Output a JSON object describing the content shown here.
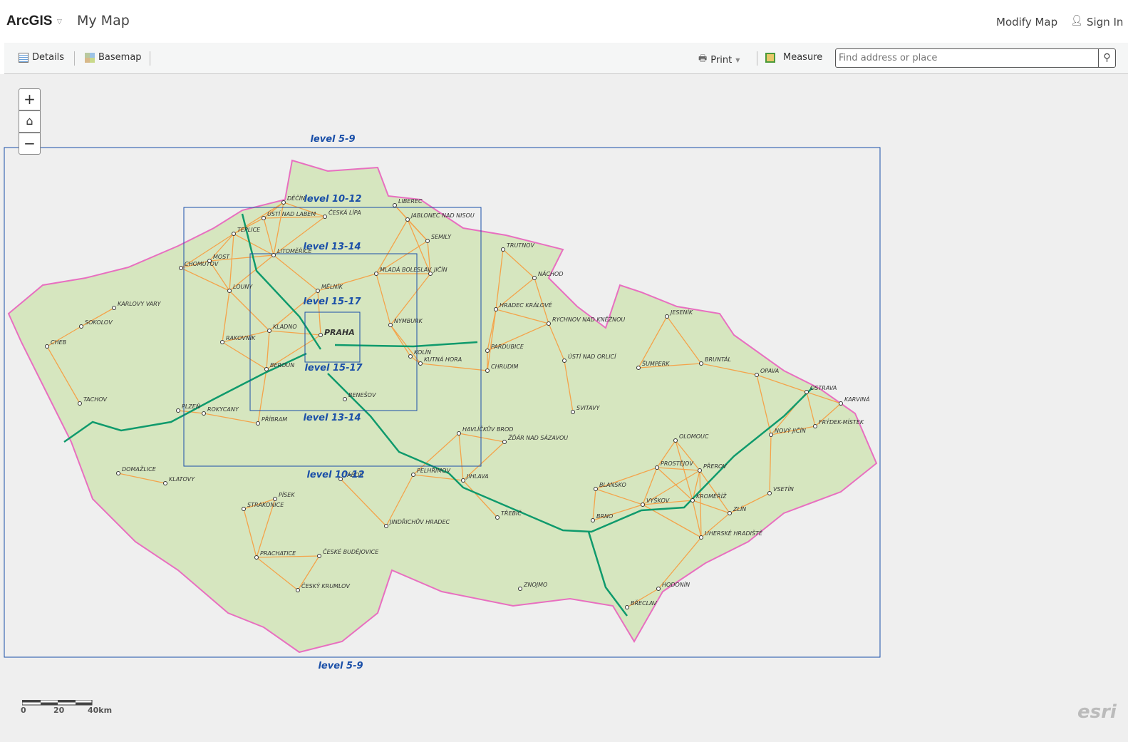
{
  "header": {
    "brand": "ArcGIS",
    "title": "My Map",
    "modify": "Modify Map",
    "sign_in": "Sign In"
  },
  "toolbar": {
    "details": "Details",
    "basemap": "Basemap",
    "print": "Print",
    "measure": "Measure",
    "search_placeholder": "Find address or place"
  },
  "map": {
    "zoom_in": "+",
    "zoom_out": "−",
    "levels": {
      "l5_9": "level 5-9",
      "l10_12": "level 10-12",
      "l13_14": "level 13-14",
      "l15_17": "level 15-17"
    },
    "cities": [
      "Praha",
      "Brno",
      "Ostrava",
      "Plzeň",
      "Olomouc",
      "Liberec",
      "Ústí nad Labem",
      "Hradec Králové",
      "Pardubice",
      "České Budějovice",
      "Jihlava",
      "Zlín",
      "Karlovy Vary",
      "Cheb",
      "Sokolov",
      "Chomutov",
      "Most",
      "Teplice",
      "Děčín",
      "Česká Lípa",
      "Jablonec nad Nisou",
      "Mladá Boleslav",
      "Mělník",
      "Kladno",
      "Beroun",
      "Rakovník",
      "Louny",
      "Litoměřice",
      "Nymburk",
      "Kolín",
      "Kutná Hora",
      "Chrudim",
      "Jičín",
      "Trutnov",
      "Náchod",
      "Semily",
      "Rychnov nad Kněžnou",
      "Ústí nad Orlicí",
      "Šumperk",
      "Jeseník",
      "Bruntál",
      "Opava",
      "Karviná",
      "Frýdek-Místek",
      "Nový Jičín",
      "Přerov",
      "Prostějov",
      "Kroměříž",
      "Vsetín",
      "Uherské Hradiště",
      "Hodonín",
      "Břeclav",
      "Vyškov",
      "Blansko",
      "Znojmo",
      "Třebíč",
      "Žďár nad Sázavou",
      "Svitavy",
      "Havlíčkův Brod",
      "Pelhřimov",
      "Tábor",
      "Benešov",
      "Příbram",
      "Rokycany",
      "Tachov",
      "Domažlice",
      "Klatovy",
      "Strakonice",
      "Písek",
      "Prachatice",
      "Český Krumlov",
      "Jindřichův Hradec"
    ],
    "scale": {
      "labels": [
        "0",
        "20",
        "40km"
      ]
    },
    "attribution": "esri"
  },
  "colors": {
    "land": "#cfe3b0",
    "boundary": "#e86fc0",
    "highway": "#0f9a6c",
    "road": "#f4a34a",
    "box": "#1a4fa8",
    "map_bg": "#efefef"
  }
}
